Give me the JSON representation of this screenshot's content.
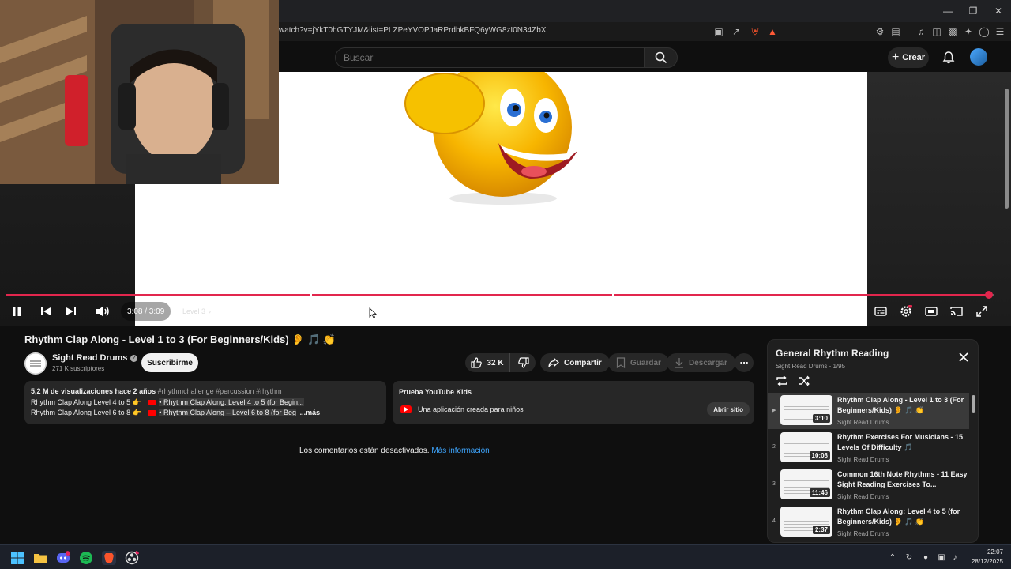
{
  "browser": {
    "url": "watch?v=jYkT0hGTYJM&list=PLZPeYVOPJaRPrdhkBFQ6yWG8zI0N34ZbX",
    "extension_badge": "1"
  },
  "header": {
    "search_placeholder": "Buscar",
    "create_label": "Crear"
  },
  "player": {
    "time": "3:08 / 3:09",
    "chapter": "Level 3",
    "progress_fraction": 0.995
  },
  "video": {
    "title": "Rhythm Clap Along - Level 1 to 3 (For Beginners/Kids) 👂 🎵 👏",
    "channel": "Sight Read Drums",
    "subscribers": "271 K suscriptores",
    "subscribe_label": "Suscribirme",
    "likes": "32 K",
    "share_label": "Compartir",
    "save_label": "Guardar",
    "download_label": "Descargar"
  },
  "description": {
    "stats": "5,2 M de visualizaciones  hace 2 años",
    "tags": " #rhythmchallenge #percussion #rhythm",
    "line2_left": "Rhythm Clap Along Level 4 to 5 👉",
    "line2_link": "• Rhythm Clap Along: Level 4 to 5 (for Begin...",
    "line3_left": "Rhythm Clap Along Level 6 to 8 👉",
    "line3_link": "• Rhythm Clap Along – Level 6 to 8 (for Beg",
    "more": "...más"
  },
  "kids_promo": {
    "title": "Prueba YouTube Kids",
    "text": "Una aplicación creada para niños",
    "button": "Abrir sitio"
  },
  "comments": {
    "text": "Los comentarios están desactivados.",
    "link": "Más información"
  },
  "playlist": {
    "title": "General Rhythm Reading",
    "subtitle": "Sight Read Drums - 1/95",
    "items": [
      {
        "index": "▶",
        "title": "Rhythm Clap Along - Level 1 to 3 (For Beginners/Kids) 👂 🎵 👏",
        "channel": "Sight Read Drums",
        "duration": "3:10"
      },
      {
        "index": "2",
        "title": "Rhythm Exercises For Musicians - 15 Levels Of Difficulty 🎵",
        "channel": "Sight Read Drums",
        "duration": "10:08"
      },
      {
        "index": "3",
        "title": "Common 16th Note Rhythms - 11 Easy Sight Reading Exercises To...",
        "channel": "Sight Read Drums",
        "duration": "11:46"
      },
      {
        "index": "4",
        "title": "Rhythm Clap Along: Level 4 to 5 (for Beginners/Kids) 👂 🎵 👏",
        "channel": "Sight Read Drums",
        "duration": "2:37"
      }
    ]
  },
  "taskbar": {
    "time": "22:07",
    "date": "28/12/2025"
  },
  "colors": {
    "accent_red": "#e2264d",
    "link_blue": "#3ea6ff"
  }
}
